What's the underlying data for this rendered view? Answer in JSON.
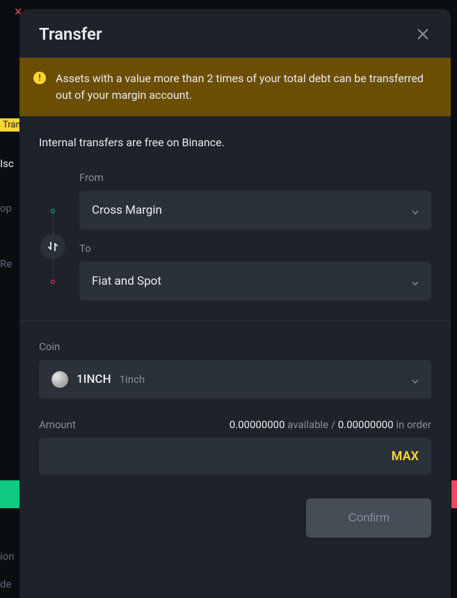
{
  "modal": {
    "title": "Transfer",
    "warning": "Assets with a value more than 2 times of your total debt can be transferred out of your margin account.",
    "info": "Internal transfers are free on Binance.",
    "from_label": "From",
    "from_value": "Cross Margin",
    "to_label": "To",
    "to_value": "Fiat and Spot",
    "coin_label": "Coin",
    "coin_symbol": "1INCH",
    "coin_name": "1inch",
    "amount_label": "Amount",
    "available_value": "0.00000000",
    "available_text": "available /",
    "inorder_value": "0.00000000",
    "inorder_text": "in order",
    "max_label": "MAX",
    "confirm_label": "Confirm"
  },
  "background": {
    "tran": "Tran",
    "iso": "Isc",
    "op": "op",
    "re": "Re",
    "ion": "ion",
    "de": "de"
  }
}
